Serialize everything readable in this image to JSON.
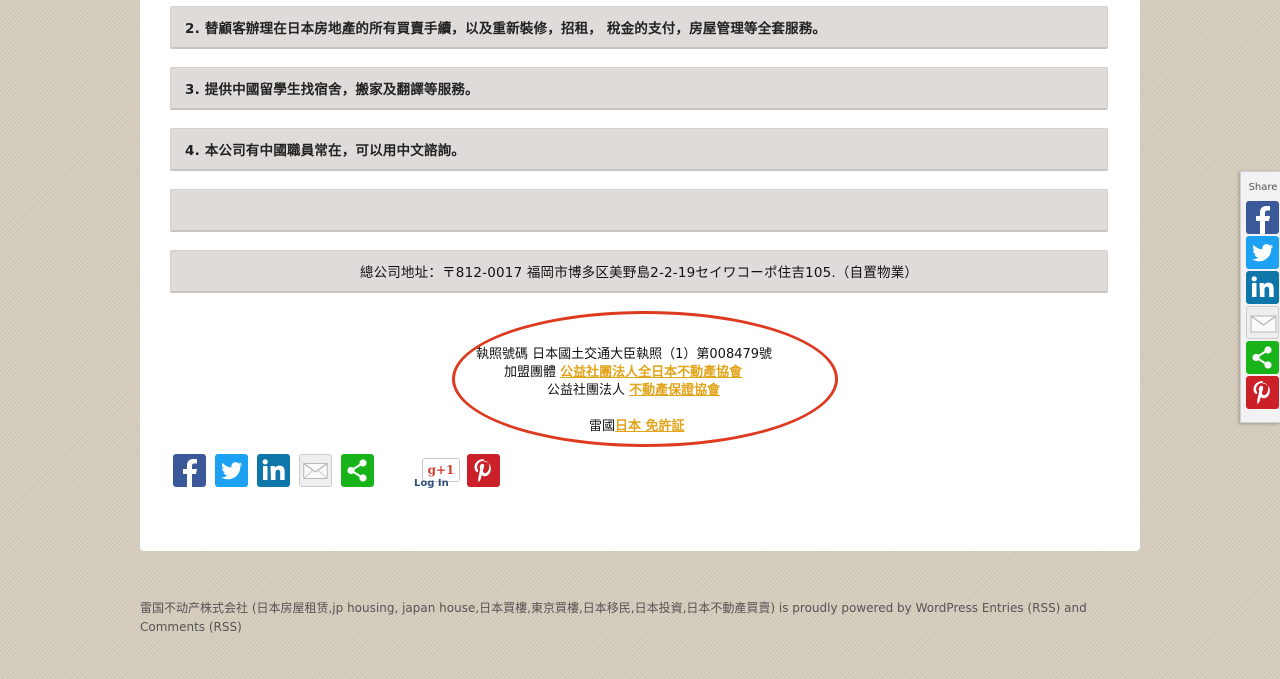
{
  "services": [
    {
      "text": "2. 替顧客辦理在日本房地產的所有買賣手續，以及重新裝修，招租，  稅金的支付，房屋管理等全套服務。"
    },
    {
      "text": "3. 提供中國留學生找宿舍，搬家及翻譯等服務。"
    },
    {
      "text": "4. 本公司有中國職員常在，可以用中文諮詢。"
    },
    {
      "text": ""
    }
  ],
  "address": "總公司地址：〒812-0017  福岡市博多区美野島2-2-19セイワコーポ住吉105.（自置物業）",
  "license": {
    "line1": "執照號碼     日本國土交通大臣執照（1）第008479號",
    "line2_label": "加盟團體     ",
    "line2_link": "公益社團法人全日本不動產協會",
    "line3_label": "公益社團法人 ",
    "line3_link": "不動產保證協會",
    "line4_label": "雷國",
    "line4_link": "日本 免許証"
  },
  "share_buttons": [
    {
      "name": "facebook",
      "color": "#3b5998"
    },
    {
      "name": "twitter",
      "color": "#1da1f2"
    },
    {
      "name": "linkedin",
      "color": "#0e76a8"
    },
    {
      "name": "email",
      "color": "#e8e8e8"
    },
    {
      "name": "share",
      "color": "#18b318"
    },
    {
      "name": "pinterest",
      "color": "#cb2027"
    }
  ],
  "gplus": {
    "label": "g+1",
    "login": "Log In"
  },
  "side_share": {
    "label": "Share"
  },
  "footer": {
    "text": "雷国不动产株式会社 (日本房屋租赁,jp housing, japan house,日本買樓,東京買樓,日本移民,日本投資,日本不動產買賣) is proudly powered by WordPress Entries (RSS) and Comments (RSS)"
  },
  "colors": {
    "link": "#e2a41b",
    "oval": "#dd3a1f",
    "box_bg": "#dedbd9"
  }
}
